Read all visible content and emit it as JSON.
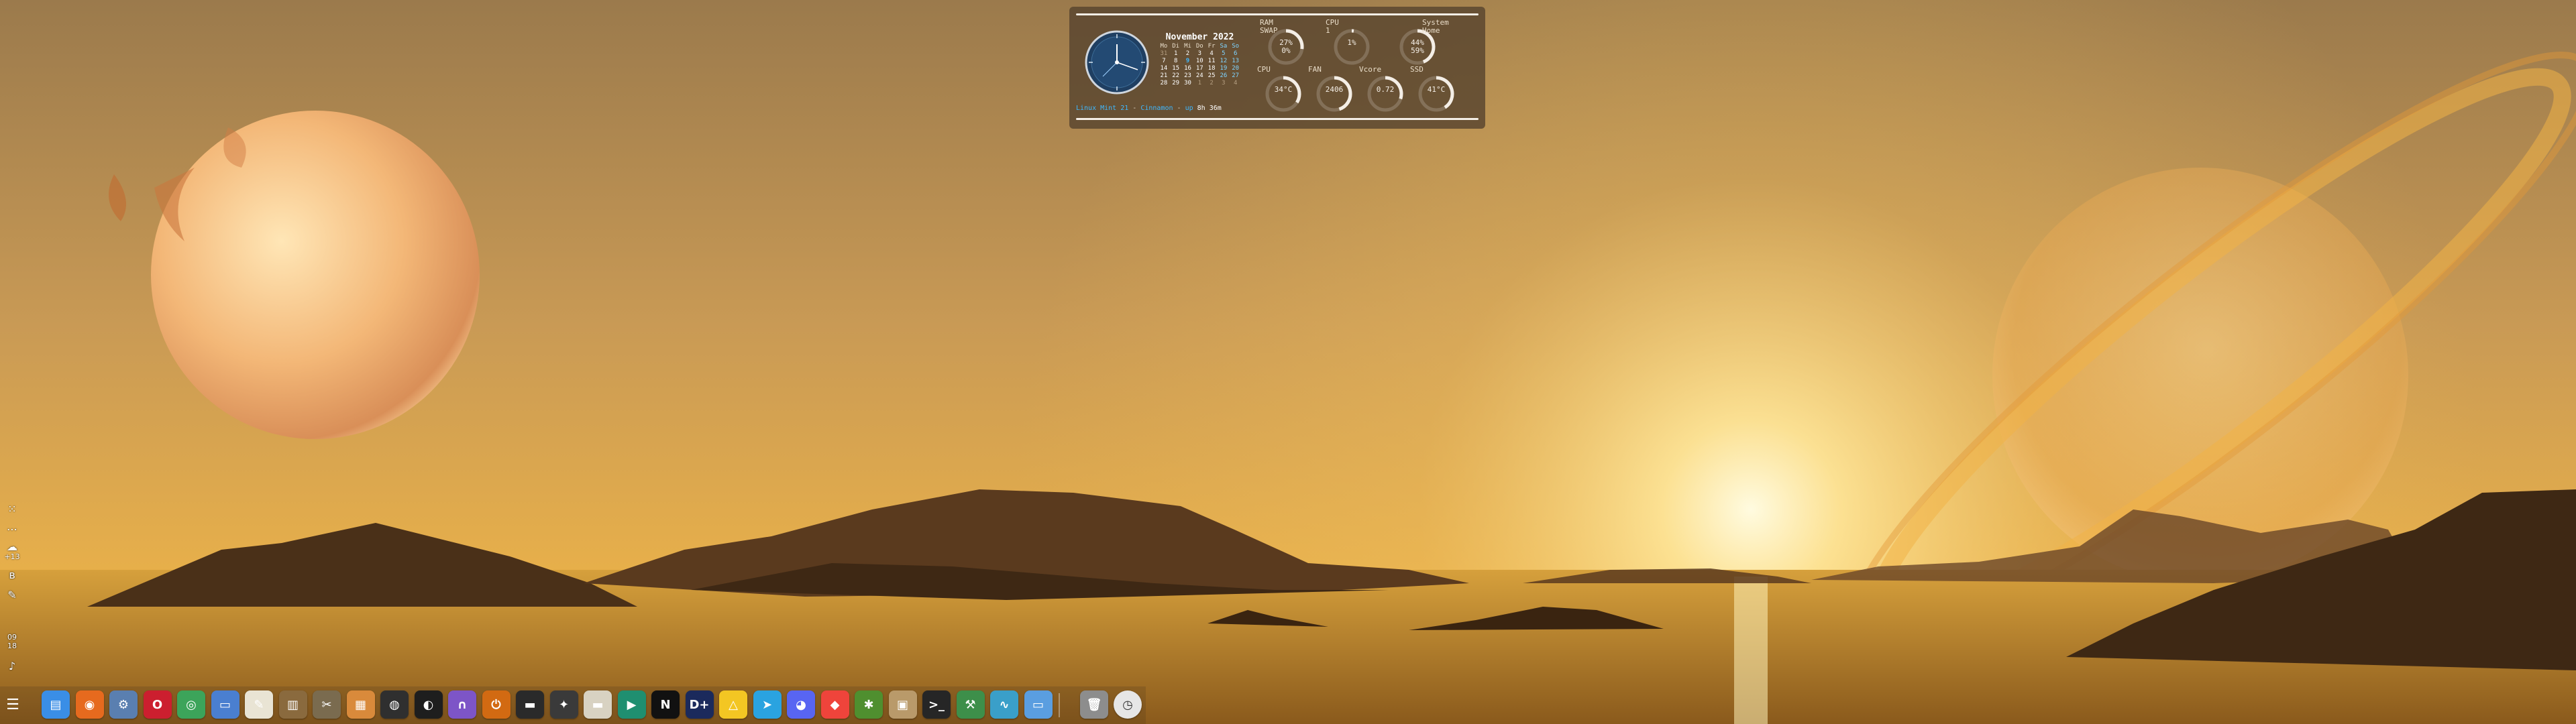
{
  "wallpaper": {
    "description_colors": [
      "#c79a5e",
      "#e8b35a",
      "#fff3c0"
    ]
  },
  "conky": {
    "calendar": {
      "title": "November  2022",
      "weekdays": [
        "Mo",
        "Di",
        "Mi",
        "Do",
        "Fr",
        "Sa",
        "So"
      ],
      "weeks": [
        [
          "31",
          "1",
          "2",
          "3",
          "4",
          "5",
          "6"
        ],
        [
          "7",
          "8",
          "9",
          "10",
          "11",
          "12",
          "13"
        ],
        [
          "14",
          "15",
          "16",
          "17",
          "18",
          "19",
          "20"
        ],
        [
          "21",
          "22",
          "23",
          "24",
          "25",
          "26",
          "27"
        ],
        [
          "28",
          "29",
          "30",
          "1",
          "2",
          "3",
          "4"
        ]
      ],
      "today": "9"
    },
    "gauges": {
      "ram": {
        "label": "RAM\nSWAP",
        "value": "27%\n0%",
        "percent": 27
      },
      "cpu1": {
        "label": "CPU\n1",
        "value": "1%",
        "percent": 1
      },
      "disk": {
        "label": "System\nHome",
        "value": "44%\n59%",
        "percent": 44
      },
      "cpu_temp": {
        "label": "CPU",
        "value": "34°C",
        "percent": 34
      },
      "fan": {
        "label": "FAN",
        "value": "2406",
        "percent": 45
      },
      "vcore": {
        "label": "Vcore",
        "value": "0.72",
        "percent": 30
      },
      "ssd": {
        "label": "SSD",
        "value": "41°C",
        "percent": 41
      }
    },
    "status": {
      "part1": "Linux Mint 21",
      "sep1": " - ",
      "part2": "Cinnamon",
      "sep2": " - ",
      "part3": "up",
      "uptime": "8h 36m"
    }
  },
  "left_panel": {
    "weather": "+13",
    "time_h": "09",
    "time_m": "18"
  },
  "dock": {
    "apps": [
      {
        "name": "files-icon",
        "color": "#3a8ee6",
        "glyph": "▤"
      },
      {
        "name": "firefox-icon",
        "color": "#e66a1e",
        "glyph": "◉"
      },
      {
        "name": "system-settings-icon",
        "color": "#5a7fb0",
        "glyph": "⚙"
      },
      {
        "name": "opera-icon",
        "color": "#cc1f2f",
        "glyph": "O"
      },
      {
        "name": "chrome-icon",
        "color": "#3ca45a",
        "glyph": "◎"
      },
      {
        "name": "document-viewer-icon",
        "color": "#4a7fd0",
        "glyph": "▭"
      },
      {
        "name": "text-editor-icon",
        "color": "#e9e4d4",
        "glyph": "✎"
      },
      {
        "name": "archive-icon",
        "color": "#8a6a3e",
        "glyph": "▥"
      },
      {
        "name": "image-editor-icon",
        "color": "#7a6b4f",
        "glyph": "✂"
      },
      {
        "name": "image-viewer-icon",
        "color": "#d98a3b",
        "glyph": "▦"
      },
      {
        "name": "disc-icon",
        "color": "#2f2f2f",
        "glyph": "◍"
      },
      {
        "name": "audio-player-icon",
        "color": "#1e1e1e",
        "glyph": "◐"
      },
      {
        "name": "headphones-icon",
        "color": "#7d55c7",
        "glyph": "∩"
      },
      {
        "name": "power-icon",
        "color": "#d26a12",
        "glyph": "⏻"
      },
      {
        "name": "clapperboard-icon",
        "color": "#2a2a2a",
        "glyph": "▬"
      },
      {
        "name": "video-editor-icon",
        "color": "#3a3a3a",
        "glyph": "✦"
      },
      {
        "name": "clapper-icon",
        "color": "#d8d2c2",
        "glyph": "▬"
      },
      {
        "name": "media-play-icon",
        "color": "#1f8f70",
        "glyph": "▶"
      },
      {
        "name": "netflix-icon",
        "color": "#111111",
        "glyph": "N"
      },
      {
        "name": "disney-plus-icon",
        "color": "#1b2a5c",
        "glyph": "D+"
      },
      {
        "name": "google-drive-icon",
        "color": "#f3c623",
        "glyph": "△"
      },
      {
        "name": "telegram-icon",
        "color": "#2aa3e0",
        "glyph": "➤"
      },
      {
        "name": "discord-icon",
        "color": "#5865f2",
        "glyph": "◕"
      },
      {
        "name": "anydesk-icon",
        "color": "#ef443b",
        "glyph": "◆"
      },
      {
        "name": "puzzle-tool-icon",
        "color": "#4f8f2f",
        "glyph": "✱"
      },
      {
        "name": "package-icon",
        "color": "#b99a6a",
        "glyph": "▣"
      },
      {
        "name": "terminal-icon",
        "color": "#262626",
        "glyph": ">_"
      },
      {
        "name": "tools-icon",
        "color": "#3d8f4a",
        "glyph": "⚒"
      },
      {
        "name": "system-monitor-icon",
        "color": "#3a9fc9",
        "glyph": "∿"
      },
      {
        "name": "desktop-icon",
        "color": "#5a9ee0",
        "glyph": "▭"
      }
    ],
    "trash_name": "trash-icon",
    "clock_name": "clock-icon"
  }
}
